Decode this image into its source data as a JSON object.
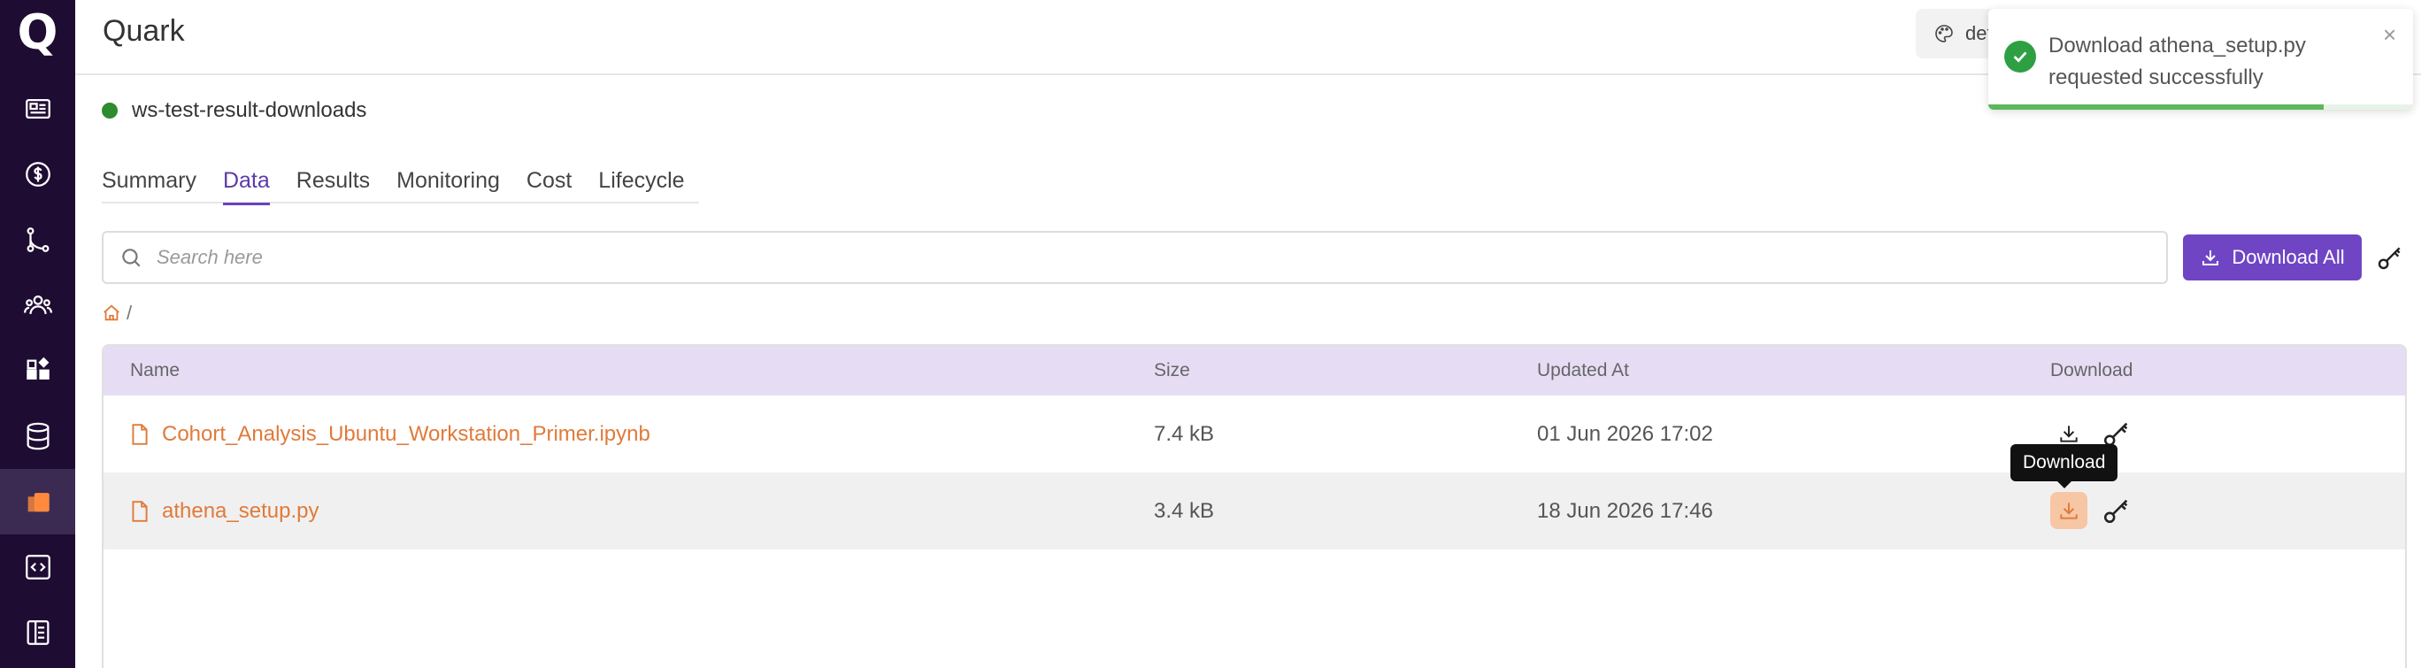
{
  "app": {
    "title": "Quark",
    "logo_letter": "Q"
  },
  "header": {
    "theme_pill_label": "def",
    "accent": "#6f45c4"
  },
  "sidebar": {
    "items": [
      {
        "icon": "newspaper-icon"
      },
      {
        "icon": "dollar-icon"
      },
      {
        "icon": "workflow-icon"
      },
      {
        "icon": "team-icon"
      },
      {
        "icon": "widgets-icon"
      },
      {
        "icon": "database-icon"
      },
      {
        "icon": "files-icon",
        "active": true
      },
      {
        "icon": "code-icon"
      },
      {
        "icon": "table-icon"
      }
    ]
  },
  "workspace": {
    "name": "ws-test-result-downloads",
    "status_color": "#2e8b2e"
  },
  "tabs": [
    {
      "label": "Summary"
    },
    {
      "label": "Data",
      "active": true
    },
    {
      "label": "Results"
    },
    {
      "label": "Monitoring"
    },
    {
      "label": "Cost"
    },
    {
      "label": "Lifecycle"
    }
  ],
  "search": {
    "placeholder": "Search here",
    "value": ""
  },
  "actions": {
    "download_all_label": "Download All"
  },
  "breadcrumb": {
    "separator": "/"
  },
  "table": {
    "columns": [
      "Name",
      "Size",
      "Updated At",
      "Download"
    ],
    "rows": [
      {
        "name": "Cohort_Analysis_Ubuntu_Workstation_Primer.ipynb",
        "size": "7.4 kB",
        "updated_at": "01 Jun 2026 17:02"
      },
      {
        "name": "athena_setup.py",
        "size": "3.4 kB",
        "updated_at": "18 Jun 2026 17:46"
      }
    ]
  },
  "tooltip": {
    "label": "Download"
  },
  "toast": {
    "message": "Download athena_setup.py requested successfully",
    "close_glyph": "×",
    "progress": 0.79,
    "color": "#2ea043"
  }
}
